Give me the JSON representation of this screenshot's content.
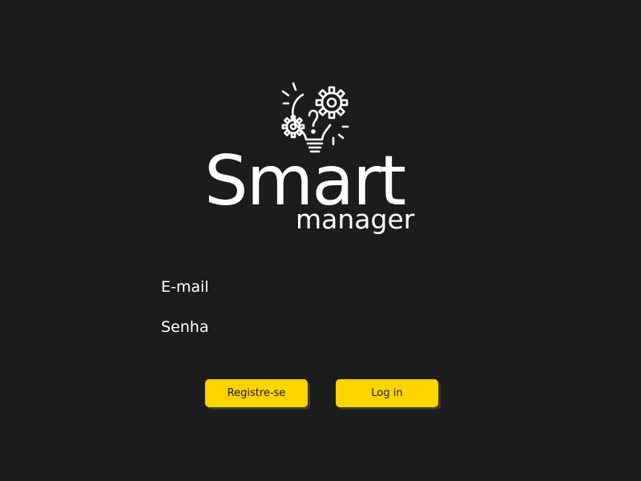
{
  "brand": {
    "title": "Smart",
    "subtitle": "manager",
    "logo_icon": "lightbulb-gears-icon"
  },
  "form": {
    "email_label": "E-mail",
    "password_label": "Senha"
  },
  "buttons": {
    "register_label": "Registre-se",
    "login_label": "Log in"
  },
  "colors": {
    "background": "#1c1c1c",
    "accent": "#fdd300",
    "text": "#ffffff"
  }
}
